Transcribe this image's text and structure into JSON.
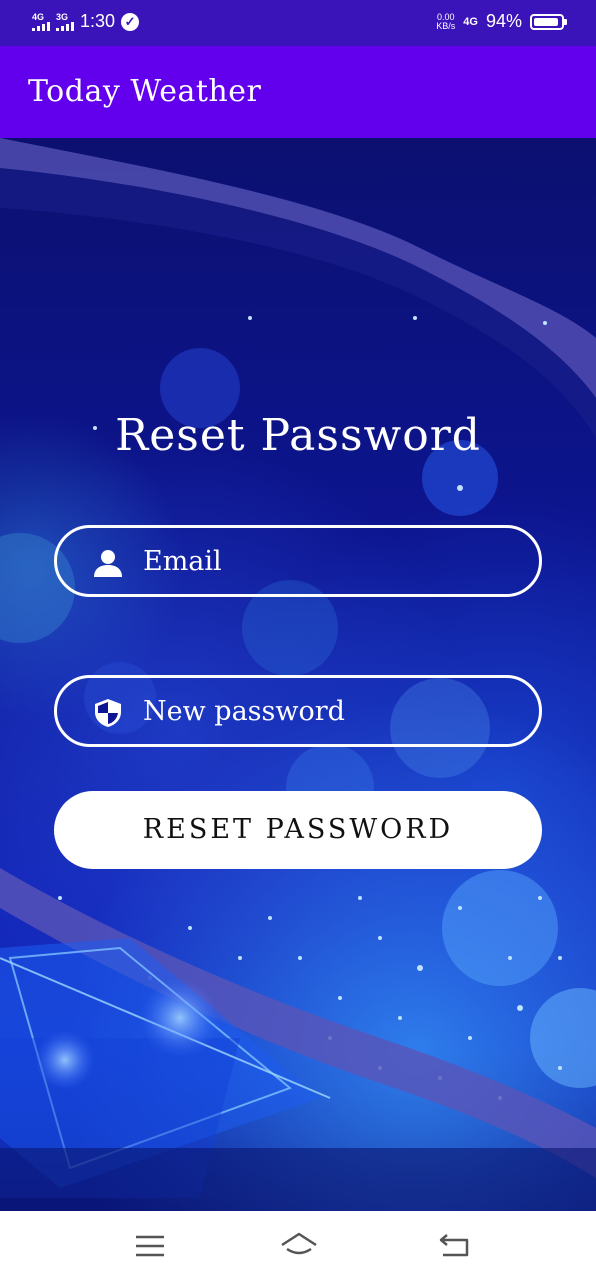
{
  "status_bar": {
    "net1": "4G",
    "net2": "3G",
    "time": "1:30",
    "speed_value": "0.00",
    "speed_unit": "KB/s",
    "net_right": "4G",
    "battery_text": "94%",
    "battery_level": 0.94
  },
  "app_bar": {
    "title": "Today Weather"
  },
  "form": {
    "heading": "Reset Password",
    "email_placeholder": "Email",
    "password_placeholder": "New password",
    "reset_label": "RESET PASSWORD"
  },
  "icons": {
    "email": "person-icon",
    "password": "shield-icon",
    "nav_menu": "menu-icon",
    "nav_home": "home-icon",
    "nav_back": "back-icon"
  },
  "colors": {
    "status_bar": "#3a14b8",
    "app_bar": "#6200ee",
    "background": "#0d1592",
    "button": "#ffffff"
  }
}
